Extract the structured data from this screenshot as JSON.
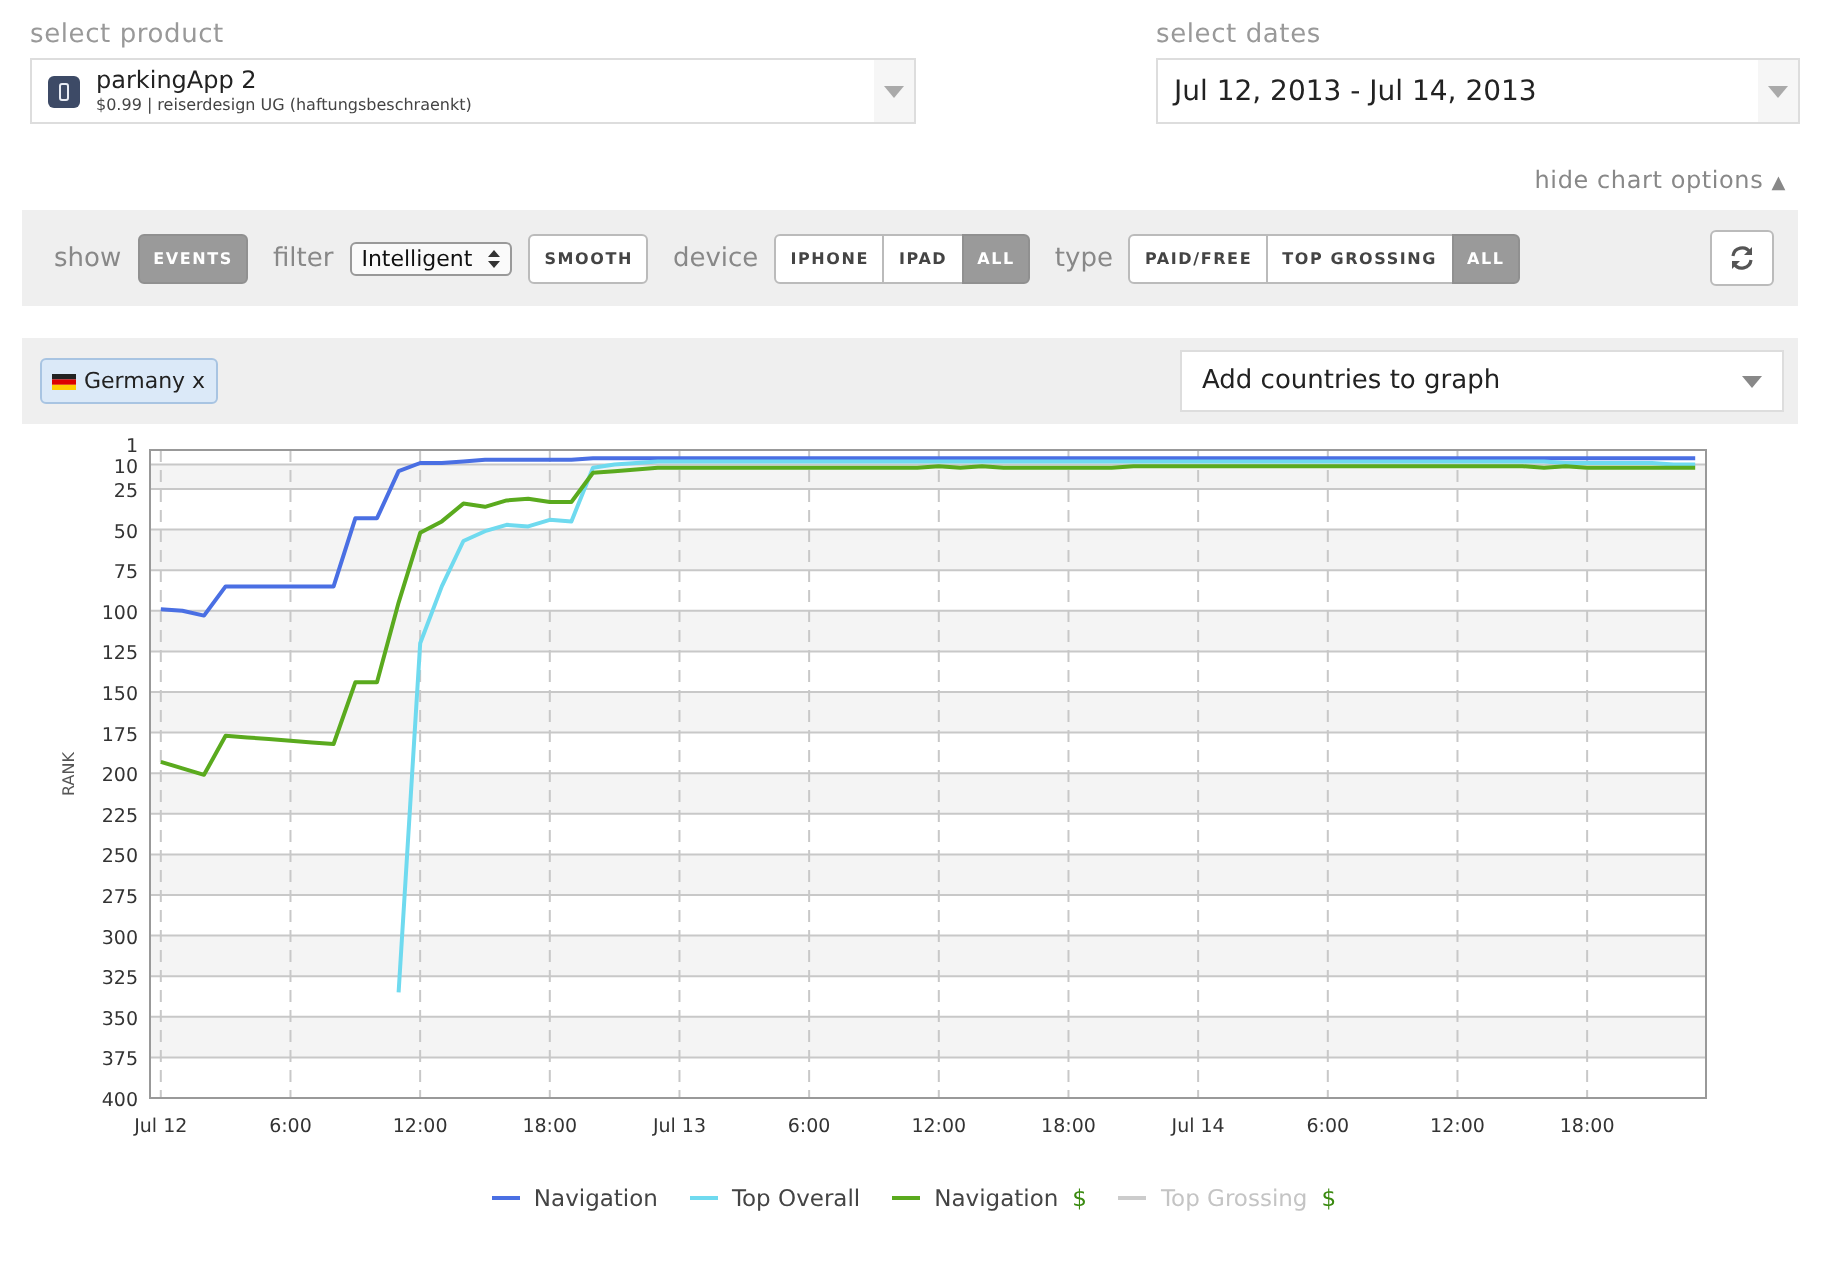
{
  "product": {
    "label": "select product",
    "name": "parkingApp 2",
    "subtitle": "$0.99 | reiserdesign UG (haftungsbeschraenkt)"
  },
  "dates": {
    "label": "select dates",
    "value": "Jul 12, 2013 - Jul 14, 2013"
  },
  "chart_options_toggle": {
    "label": "hide chart options",
    "symbol": "▲"
  },
  "options": {
    "show": {
      "label": "show",
      "buttons": [
        {
          "label": "EVENTS",
          "selected": true
        }
      ]
    },
    "filter": {
      "label": "filter",
      "value": "Intelligent",
      "button": {
        "label": "SMOOTH",
        "selected": false
      }
    },
    "device": {
      "label": "device",
      "buttons": [
        {
          "label": "IPHONE",
          "selected": false
        },
        {
          "label": "IPAD",
          "selected": false
        },
        {
          "label": "ALL",
          "selected": true
        }
      ]
    },
    "type": {
      "label": "type",
      "buttons": [
        {
          "label": "PAID/FREE",
          "selected": false
        },
        {
          "label": "TOP GROSSING",
          "selected": false
        },
        {
          "label": "ALL",
          "selected": true
        }
      ]
    }
  },
  "countries": {
    "tags": [
      {
        "label": "Germany x"
      }
    ],
    "placeholder": "Add countries to graph"
  },
  "chart_data": {
    "type": "line",
    "ylabel": "RANK",
    "x": [
      "2013-07-12T00:00",
      "2013-07-12T01:00",
      "2013-07-12T02:00",
      "2013-07-12T03:00",
      "2013-07-12T04:00",
      "2013-07-12T05:00",
      "2013-07-12T06:00",
      "2013-07-12T07:00",
      "2013-07-12T08:00",
      "2013-07-12T09:00",
      "2013-07-12T10:00",
      "2013-07-12T11:00",
      "2013-07-12T12:00",
      "2013-07-12T13:00",
      "2013-07-12T14:00",
      "2013-07-12T15:00",
      "2013-07-12T16:00",
      "2013-07-12T17:00",
      "2013-07-12T18:00",
      "2013-07-12T19:00",
      "2013-07-12T20:00",
      "2013-07-12T21:00",
      "2013-07-12T22:00",
      "2013-07-12T23:00",
      "2013-07-13T00:00",
      "2013-07-13T01:00",
      "2013-07-13T02:00",
      "2013-07-13T03:00",
      "2013-07-13T04:00",
      "2013-07-13T05:00",
      "2013-07-13T06:00",
      "2013-07-13T07:00",
      "2013-07-13T08:00",
      "2013-07-13T09:00",
      "2013-07-13T10:00",
      "2013-07-13T11:00",
      "2013-07-13T12:00",
      "2013-07-13T13:00",
      "2013-07-13T14:00",
      "2013-07-13T15:00",
      "2013-07-13T16:00",
      "2013-07-13T17:00",
      "2013-07-13T18:00",
      "2013-07-13T19:00",
      "2013-07-13T20:00",
      "2013-07-13T21:00",
      "2013-07-13T22:00",
      "2013-07-13T23:00",
      "2013-07-14T00:00",
      "2013-07-14T01:00",
      "2013-07-14T02:00",
      "2013-07-14T03:00",
      "2013-07-14T04:00",
      "2013-07-14T05:00",
      "2013-07-14T06:00",
      "2013-07-14T07:00",
      "2013-07-14T08:00",
      "2013-07-14T09:00",
      "2013-07-14T10:00",
      "2013-07-14T11:00",
      "2013-07-14T12:00",
      "2013-07-14T13:00",
      "2013-07-14T14:00",
      "2013-07-14T15:00",
      "2013-07-14T16:00",
      "2013-07-14T17:00",
      "2013-07-14T18:00",
      "2013-07-14T19:00",
      "2013-07-14T20:00",
      "2013-07-14T21:00",
      "2013-07-14T22:00",
      "2013-07-14T23:00"
    ],
    "xticks": [
      {
        "value": "2013-07-12T00:00",
        "label": "Jul 12"
      },
      {
        "value": "2013-07-12T06:00",
        "label": "6:00"
      },
      {
        "value": "2013-07-12T12:00",
        "label": "12:00"
      },
      {
        "value": "2013-07-12T18:00",
        "label": "18:00"
      },
      {
        "value": "2013-07-13T00:00",
        "label": "Jul 13"
      },
      {
        "value": "2013-07-13T06:00",
        "label": "6:00"
      },
      {
        "value": "2013-07-13T12:00",
        "label": "12:00"
      },
      {
        "value": "2013-07-13T18:00",
        "label": "18:00"
      },
      {
        "value": "2013-07-14T00:00",
        "label": "Jul 14"
      },
      {
        "value": "2013-07-14T06:00",
        "label": "6:00"
      },
      {
        "value": "2013-07-14T12:00",
        "label": "12:00"
      },
      {
        "value": "2013-07-14T18:00",
        "label": "18:00"
      }
    ],
    "xlim": [
      "2013-07-11T23:30",
      "2013-07-14T23:30"
    ],
    "ylim": [
      400,
      1
    ],
    "grid": true,
    "legend": "bottom",
    "yticks": [
      1,
      10,
      25,
      50,
      75,
      100,
      125,
      150,
      175,
      200,
      225,
      250,
      275,
      300,
      325,
      350,
      375,
      400
    ],
    "series": [
      {
        "name": "Navigation",
        "color": "#4a6fe3",
        "values": [
          99,
          100,
          103,
          85,
          85,
          85,
          85,
          85,
          85,
          43,
          43,
          14,
          9,
          9,
          8,
          7,
          7,
          7,
          7,
          7,
          6,
          6,
          6,
          6,
          6,
          6,
          6,
          6,
          6,
          6,
          6,
          6,
          6,
          6,
          6,
          6,
          6,
          6,
          6,
          6,
          6,
          6,
          6,
          6,
          6,
          6,
          6,
          6,
          6,
          6,
          6,
          6,
          6,
          6,
          6,
          6,
          6,
          6,
          6,
          6,
          6,
          6,
          6,
          6,
          6,
          6,
          6,
          6,
          6,
          6,
          6,
          6
        ]
      },
      {
        "name": "Top Overall",
        "color": "#6fdaef",
        "values": [
          null,
          null,
          null,
          null,
          null,
          null,
          null,
          null,
          null,
          null,
          null,
          335,
          120,
          85,
          57,
          51,
          47,
          48,
          44,
          45,
          12,
          10,
          9,
          8,
          8,
          8,
          8,
          8,
          8,
          8,
          8,
          8,
          8,
          8,
          8,
          8,
          8,
          8,
          8,
          8,
          8,
          8,
          8,
          8,
          8,
          8,
          8,
          8,
          8,
          8,
          8,
          8,
          8,
          8,
          8,
          8,
          8,
          8,
          8,
          8,
          8,
          8,
          8,
          8,
          8,
          9,
          9,
          9,
          9,
          9,
          10,
          10
        ]
      },
      {
        "name": "Navigation",
        "color": "#5aaa1e",
        "values": [
          193,
          197,
          201,
          177,
          178,
          179,
          180,
          181,
          182,
          144,
          144,
          95,
          52,
          45,
          34,
          36,
          32,
          31,
          33,
          33,
          15,
          14,
          13,
          12,
          12,
          12,
          12,
          12,
          12,
          12,
          12,
          12,
          12,
          12,
          12,
          12,
          11,
          12,
          11,
          12,
          12,
          12,
          12,
          12,
          12,
          11,
          11,
          11,
          11,
          11,
          11,
          11,
          11,
          11,
          11,
          11,
          11,
          11,
          11,
          11,
          11,
          11,
          11,
          11,
          12,
          11,
          12,
          12,
          12,
          12,
          12,
          12
        ]
      },
      {
        "name": "Top Grossing",
        "color": "#cccccc",
        "values": [
          null,
          null,
          null,
          null,
          null,
          null,
          null,
          null,
          null,
          null,
          null,
          null,
          null,
          null,
          null,
          null,
          null,
          null,
          null,
          null,
          null,
          null,
          null,
          null,
          null,
          null,
          null,
          null,
          null,
          null,
          null,
          null,
          null,
          null,
          null,
          null,
          null,
          null,
          null,
          null,
          null,
          null,
          null,
          null,
          null,
          null,
          null,
          null,
          null,
          null,
          null,
          null,
          null,
          null,
          null,
          null,
          null,
          null,
          null,
          null,
          null,
          null,
          null,
          null,
          null,
          null,
          null,
          null,
          null,
          null,
          null,
          null
        ]
      }
    ]
  },
  "series_toggles": [
    {
      "enabled": true
    },
    {
      "enabled": true
    },
    {
      "suffix": "$",
      "enabled": true
    },
    {
      "suffix": "$",
      "enabled": false
    }
  ]
}
